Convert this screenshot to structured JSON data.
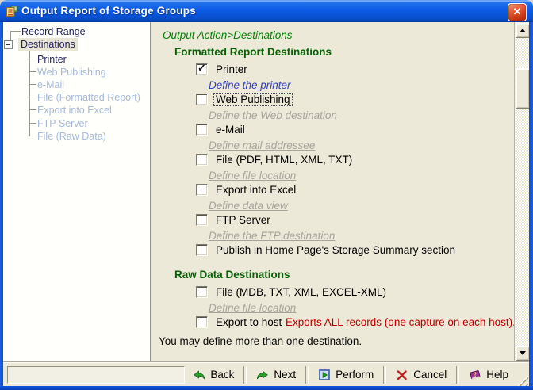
{
  "window": {
    "title": "Output Report of Storage Groups",
    "close_glyph": "✕"
  },
  "sidebar": {
    "items": [
      {
        "label": "Record Range",
        "level": 0,
        "state": "normal"
      },
      {
        "label": "Destinations",
        "level": 0,
        "state": "selected",
        "expander": "minus"
      },
      {
        "label": "Printer",
        "level": 1,
        "state": "normal"
      },
      {
        "label": "Web Publishing",
        "level": 1,
        "state": "disabled"
      },
      {
        "label": "e-Mail",
        "level": 1,
        "state": "disabled"
      },
      {
        "label": "File (Formatted Report)",
        "level": 1,
        "state": "disabled"
      },
      {
        "label": "Export into Excel",
        "level": 1,
        "state": "disabled"
      },
      {
        "label": "FTP Server",
        "level": 1,
        "state": "disabled"
      },
      {
        "label": "File (Raw Data)",
        "level": 1,
        "state": "disabled"
      }
    ]
  },
  "content": {
    "breadcrumb": "Output Action>Destinations",
    "formatted": {
      "heading": "Formatted Report Destinations",
      "rows": [
        {
          "label": "Printer",
          "checked": true
        },
        {
          "link": "Define the printer",
          "enabled": true
        },
        {
          "label": "Web Publishing",
          "checked": false,
          "focused": true
        },
        {
          "link": "Define the Web destination",
          "enabled": false
        },
        {
          "label": "e-Mail",
          "checked": false
        },
        {
          "link": "Define mail addressee",
          "enabled": false
        },
        {
          "label": "File (PDF, HTML, XML, TXT)",
          "checked": false
        },
        {
          "link": "Define file location",
          "enabled": false
        },
        {
          "label": "Export into Excel",
          "checked": false
        },
        {
          "link": "Define data view",
          "enabled": false
        },
        {
          "label": "FTP Server",
          "checked": false
        },
        {
          "link": "Define the FTP destination",
          "enabled": false
        },
        {
          "label": "Publish in Home Page's Storage Summary section",
          "checked": false
        }
      ]
    },
    "raw": {
      "heading": "Raw Data Destinations",
      "rows": [
        {
          "label": "File (MDB, TXT, XML, EXCEL-XML)",
          "checked": false
        },
        {
          "link": "Define file location",
          "enabled": false
        },
        {
          "label": "Export to host",
          "checked": false,
          "warning": "Exports ALL records (one capture on each host)."
        }
      ]
    },
    "footer_note": "You may define more than one destination."
  },
  "toolbar": {
    "buttons": [
      {
        "label": "Back",
        "icon": "back-arrow-icon"
      },
      {
        "label": "Next",
        "icon": "next-arrow-icon"
      },
      {
        "label": "Perform",
        "icon": "perform-play-icon"
      },
      {
        "label": "Cancel",
        "icon": "cancel-x-icon"
      },
      {
        "label": "Help",
        "icon": "help-book-icon"
      }
    ]
  },
  "colors": {
    "frame_blue": "#0d4fd0",
    "panel_bg": "#ece9d8",
    "sidebar_bg": "#fffffc",
    "breadcrumb_green": "#068006",
    "heading_green": "#056205",
    "link_blue": "#3340bd",
    "disabled_link_grey": "#a6a49c",
    "warning_red": "#c00000",
    "tree_text": "#23235e",
    "tree_disabled": "#a6bad8"
  }
}
